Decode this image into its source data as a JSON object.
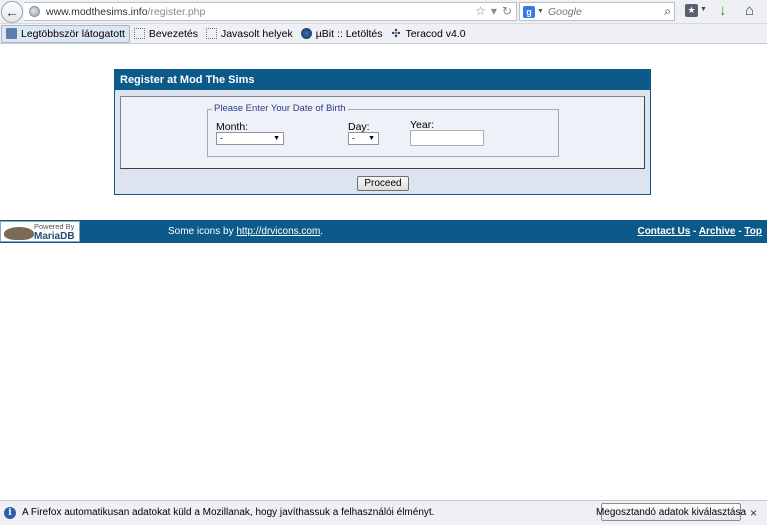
{
  "browser": {
    "url_host": "www.modthesims.info",
    "url_path": "/register.php",
    "search_placeholder": "Google",
    "bookmarks": [
      {
        "label": "Legtöbbször látogatott"
      },
      {
        "label": "Bevezetés"
      },
      {
        "label": "Javasolt helyek"
      },
      {
        "label": "µBit :: Letöltés"
      },
      {
        "label": "Teracod v4.0"
      }
    ]
  },
  "register": {
    "title": "Register at Mod The Sims",
    "legend": "Please Enter Your Date of Birth",
    "month_label": "Month:",
    "month_value": "-",
    "day_label": "Day:",
    "day_value": "-",
    "year_label": "Year:",
    "year_value": "",
    "proceed_label": "Proceed"
  },
  "footer": {
    "powered_by": "Powered By",
    "mariadb": "MariaDB",
    "icons_prefix": "Some icons by ",
    "icons_link": "http://drvicons.com",
    "icons_suffix": ".",
    "links": {
      "contact": "Contact Us",
      "archive": "Archive",
      "top": "Top",
      "separator": "-"
    }
  },
  "notification": {
    "text": "A Firefox automatikusan adatokat küld a Mozillanak, hogy javíthassuk a felhasználói élményt.",
    "button_label": "Megosztandó adatok kiválasztása",
    "close": "×"
  }
}
